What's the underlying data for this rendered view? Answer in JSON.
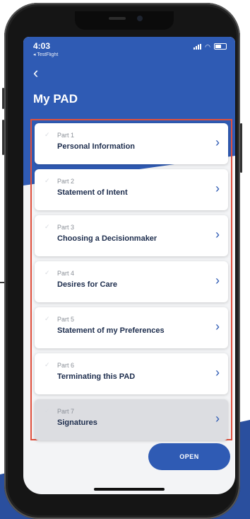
{
  "status_bar": {
    "time": "4:03",
    "back_app": "◂ TestFlight"
  },
  "header": {
    "back_icon": "chevron-left-icon",
    "title": "My PAD"
  },
  "parts": [
    {
      "part": "Part 1",
      "title": "Personal Information"
    },
    {
      "part": "Part 2",
      "title": "Statement of Intent"
    },
    {
      "part": "Part 3",
      "title": "Choosing a Decisionmaker"
    },
    {
      "part": "Part 4",
      "title": "Desires for Care"
    },
    {
      "part": "Part 5",
      "title": "Statement of my Preferences"
    },
    {
      "part": "Part 6",
      "title": "Terminating this PAD"
    },
    {
      "part": "Part 7",
      "title": "Signatures"
    }
  ],
  "actions": {
    "open_label": "OPEN"
  },
  "colors": {
    "header": "#2f5bb4",
    "highlight_border": "#e0503d",
    "card_title": "#1d2d4d"
  }
}
